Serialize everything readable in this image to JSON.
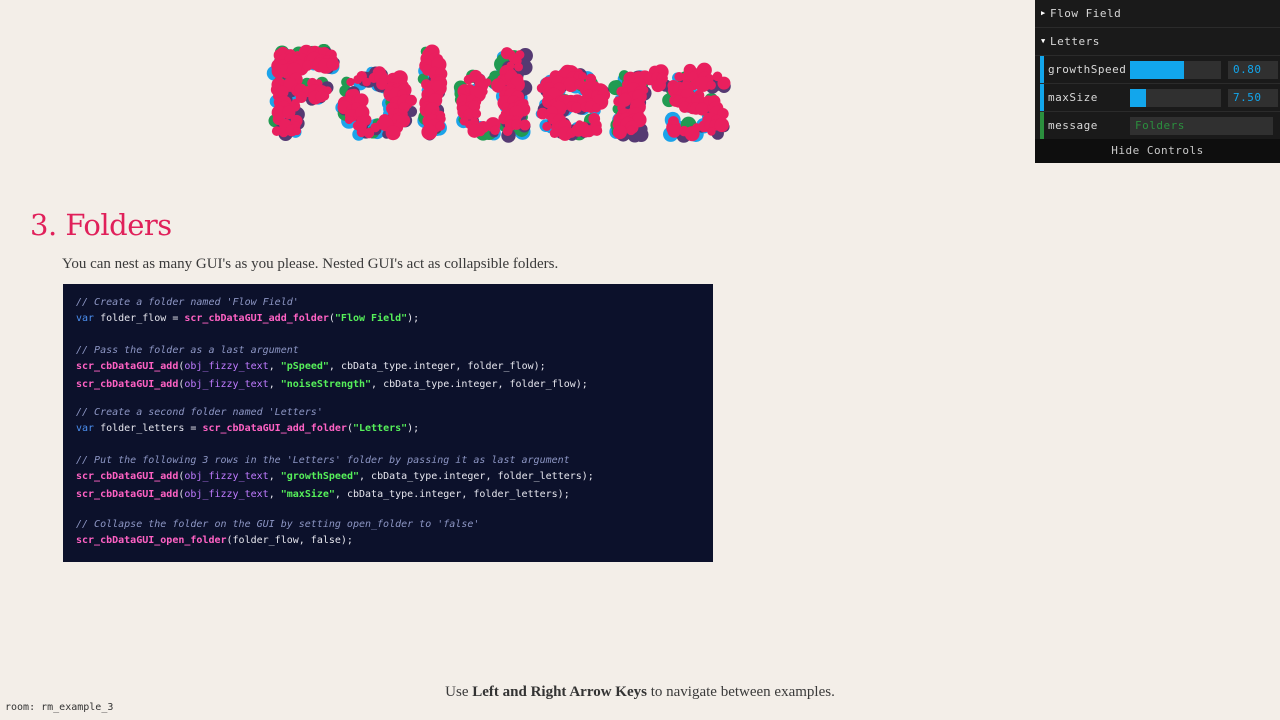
{
  "logo": {
    "text": "Folders",
    "colors": {
      "primary": "#e91f5e",
      "secondary": "#1ca3ea",
      "tertiary": "#219b52",
      "shadow": "#553a72"
    }
  },
  "gui": {
    "folders": [
      {
        "label": "Flow Field",
        "open": false
      },
      {
        "label": "Letters",
        "open": true
      }
    ],
    "rows": [
      {
        "label": "growthSpeed",
        "value": "0.80",
        "fill": 0.59,
        "bar_color": "#12a6ec"
      },
      {
        "label": "maxSize",
        "value": "7.50",
        "fill": 0.18,
        "bar_color": "#12a6ec"
      },
      {
        "label": "message",
        "value": "Folders",
        "bar_color": "#2b8f3e"
      }
    ],
    "hide_label": "Hide Controls"
  },
  "heading": "3. Folders",
  "description": "You can nest as many GUI's as you please. Nested GUI's act as collapsible folders.",
  "code": {
    "line1": "// Create a folder named 'Flow Field'",
    "line2_kw": "var",
    "line2_a": " folder_flow = ",
    "line2_fn": "scr_cbDataGUI_add_folder",
    "line2_b": "(",
    "line2_st": "\"Flow Field\"",
    "line2_c": ");",
    "line3": "// Pass the folder as a last argument",
    "line4_fn": "scr_cbDataGUI_add",
    "line4_ob": "obj_fizzy_text",
    "line4_st": "\"pSpeed\"",
    "line4_c": ", cbData_type.integer, folder_flow);",
    "line5_fn": "scr_cbDataGUI_add",
    "line5_ob": "obj_fizzy_text",
    "line5_st": "\"noiseStrength\"",
    "line5_c": ", cbData_type.integer, folder_flow);",
    "line6": "// Create a second folder named 'Letters'",
    "line7_kw": "var",
    "line7_a": " folder_letters = ",
    "line7_fn": "scr_cbDataGUI_add_folder",
    "line7_st": "\"Letters\"",
    "line7_c": ");",
    "line8": "// Put the following 3 rows in the 'Letters' folder by passing it as last argument",
    "line9_fn": "scr_cbDataGUI_add",
    "line9_ob": "obj_fizzy_text",
    "line9_st": "\"growthSpeed\"",
    "line9_c": ", cbData_type.integer, folder_letters);",
    "line10_fn": "scr_cbDataGUI_add",
    "line10_ob": "obj_fizzy_text",
    "line10_st": "\"maxSize\"",
    "line10_c": ", cbData_type.integer, folder_letters);",
    "line11": "// Collapse the folder on the GUI by setting open_folder to 'false'",
    "line12_fn": "scr_cbDataGUI_open_folder",
    "line12_c": "(folder_flow, false);"
  },
  "footer": {
    "pre": "Use ",
    "bold": "Left and Right Arrow Keys",
    "post": " to navigate between examples."
  },
  "room_label": "room: rm_example_3"
}
